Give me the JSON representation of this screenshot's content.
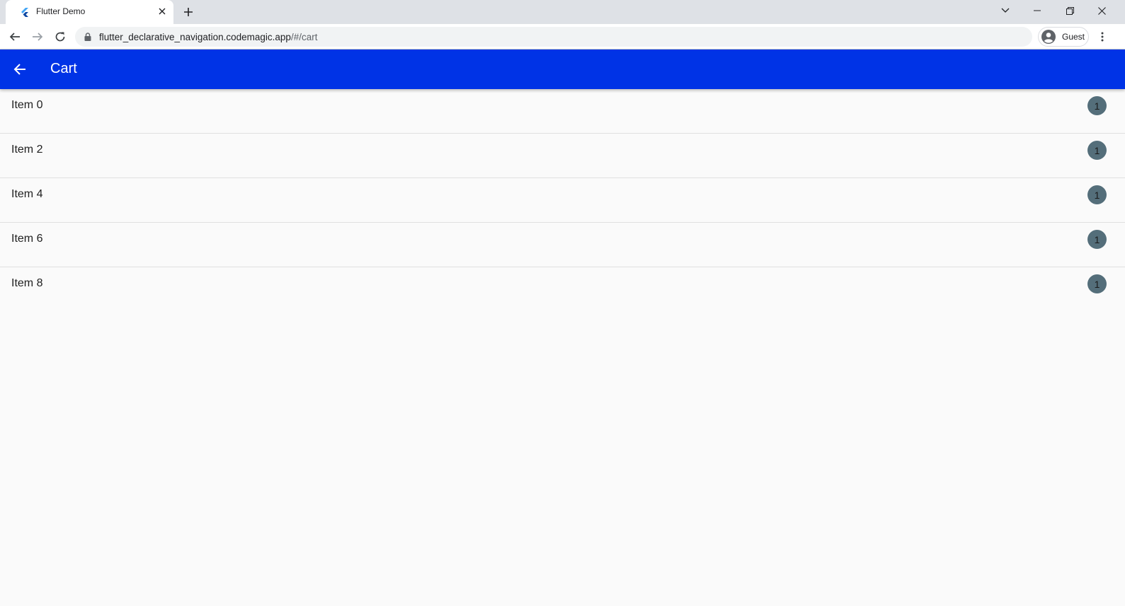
{
  "browser": {
    "tab_title": "Flutter Demo",
    "url_host": "flutter_declarative_navigation.codemagic.app",
    "url_path": "/#/cart",
    "profile_label": "Guest"
  },
  "app": {
    "title": "Cart",
    "accent_color": "#0033e6",
    "items": [
      {
        "label": "Item 0",
        "count": "1"
      },
      {
        "label": "Item 2",
        "count": "1"
      },
      {
        "label": "Item 4",
        "count": "1"
      },
      {
        "label": "Item 6",
        "count": "1"
      },
      {
        "label": "Item 8",
        "count": "1"
      }
    ]
  }
}
